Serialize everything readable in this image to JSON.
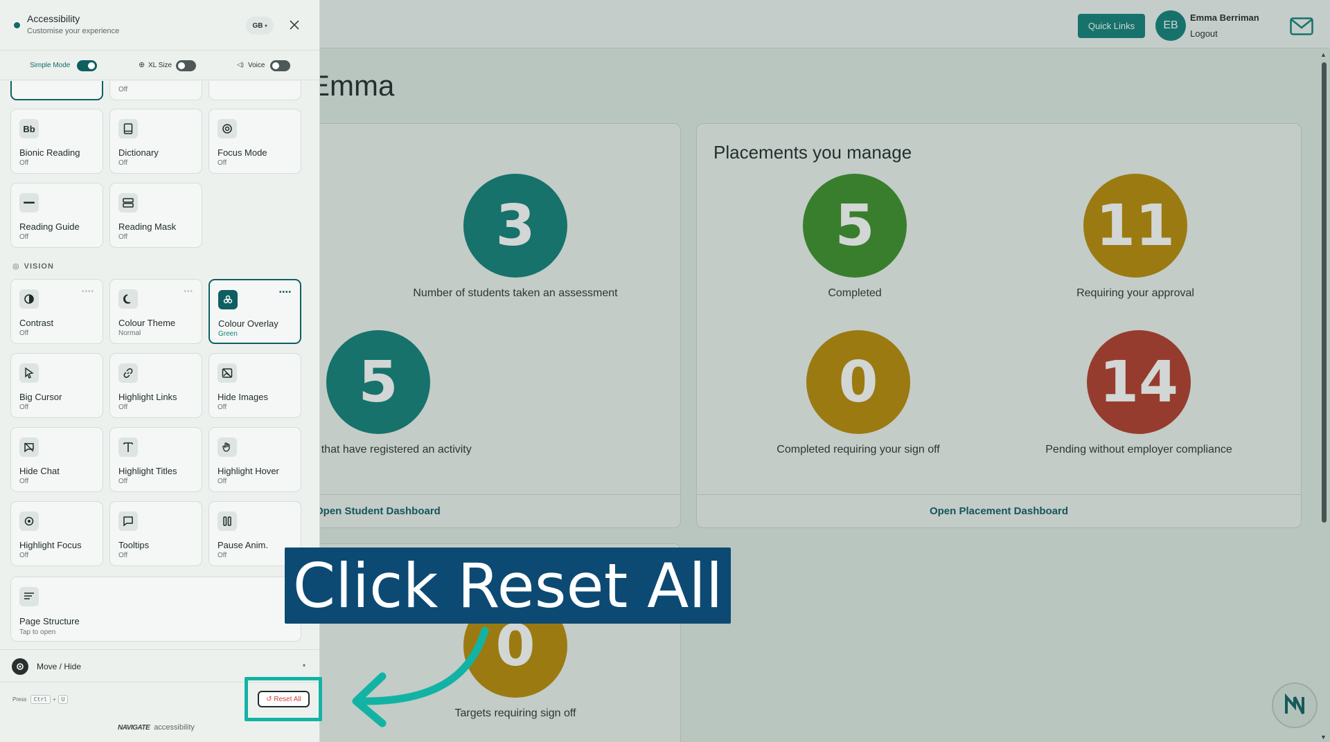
{
  "topbar": {
    "quick_links": "Quick Links",
    "user_initials": "EB",
    "user_name": "Emma Berriman",
    "logout": "Logout"
  },
  "greeting": "Emma",
  "cards": {
    "students": {
      "metrics": [
        {
          "value": "3",
          "label": "Number of students taken an assessment",
          "color": "#0f7f79"
        },
        {
          "value": "5",
          "label": "udents that have registered an activity",
          "color": "#0f7f79"
        }
      ],
      "footer": "Open Student Dashboard"
    },
    "placements": {
      "title": "Placements you manage",
      "metrics": [
        {
          "value": "5",
          "label": "Completed",
          "color": "#3c8f2a"
        },
        {
          "value": "11",
          "label": "Requiring your approval",
          "color": "#b98a06"
        },
        {
          "value": "0",
          "label": "Completed requiring your sign off",
          "color": "#b98a06"
        },
        {
          "value": "14",
          "label": "Pending without employer compliance",
          "color": "#b33a2b"
        }
      ],
      "footer": "Open Placement Dashboard"
    },
    "targets": {
      "metrics": [
        {
          "value": "0",
          "label": "Targets requiring sign off",
          "color": "#b98a06"
        }
      ]
    }
  },
  "panel": {
    "title": "Accessibility",
    "subtitle": "Customise your experience",
    "language": "GB",
    "toggles": {
      "simple_mode": "Simple Mode",
      "xl_size": "XL Size",
      "voice": "Voice"
    },
    "partial_tiles": {
      "state_2": "Off"
    },
    "tiles_top": [
      {
        "icon": "Bb",
        "name": "Bionic Reading",
        "state": "Off"
      },
      {
        "icon": "dictionary-icon",
        "name": "Dictionary",
        "state": "Off"
      },
      {
        "icon": "focus-icon",
        "name": "Focus Mode",
        "state": "Off"
      },
      {
        "icon": "reading-guide-icon",
        "name": "Reading Guide",
        "state": "Off"
      },
      {
        "icon": "reading-mask-icon",
        "name": "Reading Mask",
        "state": "Off"
      }
    ],
    "section_vision": "VISION",
    "tiles_vision": [
      {
        "icon": "contrast-icon",
        "name": "Contrast",
        "state": "Off"
      },
      {
        "icon": "moon-icon",
        "name": "Colour Theme",
        "state": "Normal"
      },
      {
        "icon": "palette-icon",
        "name": "Colour Overlay",
        "state": "Green"
      },
      {
        "icon": "cursor-icon",
        "name": "Big Cursor",
        "state": "Off"
      },
      {
        "icon": "link-icon",
        "name": "Highlight Links",
        "state": "Off"
      },
      {
        "icon": "image-off-icon",
        "name": "Hide Images",
        "state": "Off"
      },
      {
        "icon": "chat-off-icon",
        "name": "Hide Chat",
        "state": "Off"
      },
      {
        "icon": "title-icon",
        "name": "Highlight Titles",
        "state": "Off"
      },
      {
        "icon": "hand-icon",
        "name": "Highlight Hover",
        "state": "Off"
      },
      {
        "icon": "target-icon",
        "name": "Highlight Focus",
        "state": "Off"
      },
      {
        "icon": "tooltip-icon",
        "name": "Tooltips",
        "state": "Off"
      },
      {
        "icon": "pause-icon",
        "name": "Pause Anim.",
        "state": "Off"
      }
    ],
    "page_structure": {
      "name": "Page Structure",
      "state": "Tap to open"
    },
    "move_hide": "Move / Hide",
    "shortcut": {
      "press": "Press",
      "key1": "Ctrl",
      "plus": "+",
      "key2": "U"
    },
    "reset_all": "↺ Reset All",
    "brand_logo": "NAVIGATE",
    "brand_text": "accessibility"
  },
  "callout": "Click Reset All",
  "colors": {
    "accent": "#0f5f62",
    "callout_bg": "#0d4a73",
    "highlight": "#12b3a4",
    "danger": "#d23b3b"
  }
}
